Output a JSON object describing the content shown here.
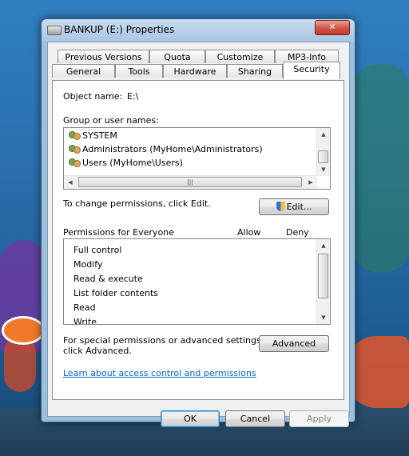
{
  "window": {
    "title": "BANKUP (E:) Properties",
    "close_label": "✕"
  },
  "tabs_row1": [
    "Previous Versions",
    "Quota",
    "Customize",
    "MP3-Info"
  ],
  "tabs_row2": [
    "General",
    "Tools",
    "Hardware",
    "Sharing",
    "Security"
  ],
  "security": {
    "object_name_label": "Object name:",
    "object_name_value": "E:\\",
    "group_label": "Group or user names:",
    "users": [
      "SYSTEM",
      "Administrators (MyHome\\Administrators)",
      "Users (MyHome\\Users)"
    ],
    "change_text": "To change permissions, click Edit.",
    "edit_label": "Edit...",
    "permissions_label": "Permissions for Everyone",
    "allow_label": "Allow",
    "deny_label": "Deny",
    "permissions": [
      "Full control",
      "Modify",
      "Read & execute",
      "List folder contents",
      "Read",
      "Write"
    ],
    "special_text_1": "For special permissions or advanced settings,",
    "special_text_2": "click Advanced.",
    "advanced_label": "Advanced",
    "learn_link": "Learn about access control and permissions"
  },
  "buttons": {
    "ok": "OK",
    "cancel": "Cancel",
    "apply": "Apply"
  },
  "scroll": {
    "up": "▲",
    "down": "▼",
    "left": "◀",
    "right": "▶",
    "grip": "|||"
  },
  "colors": {
    "titlebar": "#a8c6e2",
    "close": "#c23a2c",
    "link": "#0066cc"
  }
}
